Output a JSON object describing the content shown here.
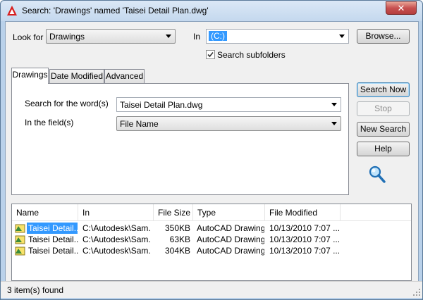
{
  "window": {
    "title": "Search: 'Drawings' named 'Taisei Detail Plan.dwg'",
    "close_label": "✕"
  },
  "lookfor": {
    "label": "Look for",
    "value": "Drawings"
  },
  "in": {
    "label": "In",
    "value": "(C:)"
  },
  "browse_label": "Browse...",
  "subfolders": {
    "label": "Search subfolders",
    "checked": true
  },
  "tabs": [
    {
      "label": "Drawings",
      "active": true
    },
    {
      "label": "Date Modified",
      "active": false
    },
    {
      "label": "Advanced",
      "active": false
    }
  ],
  "drawings_tab": {
    "words_label": "Search for the word(s)",
    "words_value": "Taisei Detail Plan.dwg",
    "field_label": "In the field(s)",
    "field_value": "File Name"
  },
  "buttons": {
    "search_now": "Search Now",
    "stop": "Stop",
    "new_search": "New Search",
    "help": "Help"
  },
  "results": {
    "columns": [
      "Name",
      "In",
      "File Size",
      "Type",
      "File Modified"
    ],
    "rows": [
      {
        "name": "Taisei Detail...",
        "in": "C:\\Autodesk\\Sam...",
        "size": "350KB",
        "type": "AutoCAD Drawing",
        "modified": "10/13/2010 7:07 ...",
        "selected": true
      },
      {
        "name": "Taisei Detail...",
        "in": "C:\\Autodesk\\Sam...",
        "size": "63KB",
        "type": "AutoCAD Drawing",
        "modified": "10/13/2010 7:07 ...",
        "selected": false
      },
      {
        "name": "Taisei Detail...",
        "in": "C:\\Autodesk\\Sam...",
        "size": "304KB",
        "type": "AutoCAD Drawing",
        "modified": "10/13/2010 7:07 ...",
        "selected": false
      }
    ]
  },
  "status": {
    "text": "3 item(s) found"
  },
  "colors": {
    "selection": "#3399ff",
    "title_close": "#c75050",
    "search_icon": "#1f6fb5"
  },
  "icons": {
    "app": "autocad-app-icon",
    "search": "magnifier-icon",
    "file": "dwg-file-icon"
  }
}
